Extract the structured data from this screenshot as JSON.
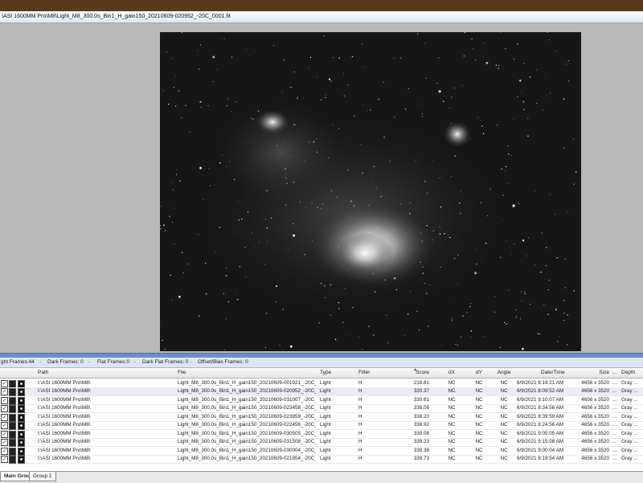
{
  "window": {
    "title": "\\ASI 1600MM Pro\\M8\\Light_M8_300.0s_Bin1_H_gain150_20210609-020952_-20C_0001.fit"
  },
  "counts": {
    "light": "ght Frames:44",
    "dark": "Dark Frames: 0",
    "flat": "Flat Frames:0",
    "dark_flat": "Dark Flat Frames: 0",
    "offset": "Offset/Bias Frames: 0"
  },
  "columns": {
    "path": "Path",
    "file": "File",
    "type": "Type",
    "filter": "Filter",
    "score": "Score",
    "dx": "dX",
    "dy": "dY",
    "angle": "Angle",
    "datetime": "Date/Time",
    "size": "Size",
    "dots": "...",
    "depth": "Depth"
  },
  "rows": [
    {
      "path": "I:\\ASI 1600MM Pro\\M8\\",
      "file": "Light_M8_300.0s_Bin1_H_gain150_20210609-001921_-20C_...",
      "type": "Light",
      "filter": "H",
      "score": "218.81",
      "dx": "NC",
      "dy": "NC",
      "angle": "NC",
      "datetime": "6/9/2021 6:19:21 AM",
      "size": "4656 x 3520",
      "dots": "...",
      "depth": "Gray ..."
    },
    {
      "path": "I:\\ASI 1600MM Pro\\M8\\",
      "file": "Light_M8_300.0s_Bin1_H_gain150_20210609-020952_-20C_...",
      "type": "Light",
      "filter": "H",
      "score": "320.37",
      "dx": "NC",
      "dy": "NC",
      "angle": "NC",
      "datetime": "6/9/2021 8:09:52 AM",
      "size": "4656 x 3520",
      "dots": "...",
      "depth": "Gray ..."
    },
    {
      "path": "I:\\ASI 1600MM Pro\\M8\\",
      "file": "Light_M8_300.0s_Bin1_H_gain150_20210609-031007_-20C_...",
      "type": "Light",
      "filter": "H",
      "score": "330.61",
      "dx": "NC",
      "dy": "NC",
      "angle": "NC",
      "datetime": "6/9/2021 9:10:07 AM",
      "size": "4656 x 3520",
      "dots": "...",
      "depth": "Gray ..."
    },
    {
      "path": "I:\\ASI 1600MM Pro\\M8\\",
      "file": "Light_M8_300.0s_Bin1_H_gain150_20210609-023458_-20C_...",
      "type": "Light",
      "filter": "H",
      "score": "338.08",
      "dx": "NC",
      "dy": "NC",
      "angle": "NC",
      "datetime": "6/9/2021 8:34:58 AM",
      "size": "4656 x 3520",
      "dots": "...",
      "depth": "Gray ..."
    },
    {
      "path": "I:\\ASI 1600MM Pro\\M8\\",
      "file": "Light_M8_300.0s_Bin1_H_gain150_20210609-023959_-20C_...",
      "type": "Light",
      "filter": "H",
      "score": "338.20",
      "dx": "NC",
      "dy": "NC",
      "angle": "NC",
      "datetime": "6/9/2021 8:39:59 AM",
      "size": "4656 x 3520",
      "dots": "...",
      "depth": "Gray ..."
    },
    {
      "path": "I:\\ASI 1600MM Pro\\M8\\",
      "file": "Light_M8_300.0s_Bin1_H_gain150_20210609-022456_-20C_...",
      "type": "Light",
      "filter": "H",
      "score": "338.92",
      "dx": "NC",
      "dy": "NC",
      "angle": "NC",
      "datetime": "6/9/2021 8:24:56 AM",
      "size": "4656 x 3520",
      "dots": "...",
      "depth": "Gray ..."
    },
    {
      "path": "I:\\ASI 1600MM Pro\\M8\\",
      "file": "Light_M8_300.0s_Bin1_H_gain150_20210609-030505_-20C_...",
      "type": "Light",
      "filter": "H",
      "score": "339.08",
      "dx": "NC",
      "dy": "NC",
      "angle": "NC",
      "datetime": "6/9/2021 9:05:05 AM",
      "size": "4656 x 3520",
      "dots": "...",
      "depth": "Gray ..."
    },
    {
      "path": "I:\\ASI 1600MM Pro\\M8\\",
      "file": "Light_M8_300.0s_Bin1_H_gain150_20210609-031508_-20C_...",
      "type": "Light",
      "filter": "H",
      "score": "339.23",
      "dx": "NC",
      "dy": "NC",
      "angle": "NC",
      "datetime": "6/9/2021 9:15:08 AM",
      "size": "4656 x 3520",
      "dots": "...",
      "depth": "Gray ..."
    },
    {
      "path": "I:\\ASI 1600MM Pro\\M8\\",
      "file": "Light_M8_300.0s_Bin1_H_gain150_20210609-030004_-20C_...",
      "type": "Light",
      "filter": "H",
      "score": "339.38",
      "dx": "NC",
      "dy": "NC",
      "angle": "NC",
      "datetime": "6/9/2021 9:00:04 AM",
      "size": "4656 x 3520",
      "dots": "...",
      "depth": "Gray ..."
    },
    {
      "path": "I:\\ASI 1600MM Pro\\M8\\",
      "file": "Light_M8_300.0s_Bin1_H_gain150_20210609-021954_-20C_...",
      "type": "Light",
      "filter": "H",
      "score": "339.73",
      "dx": "NC",
      "dy": "NC",
      "angle": "NC",
      "datetime": "6/9/2021 8:19:54 AM",
      "size": "4656 x 3520",
      "dots": "...",
      "depth": "Gray ..."
    }
  ],
  "tabs": [
    "Main Group",
    "Group 1"
  ],
  "colors": {
    "accent": "#6b90c8",
    "background": "#5a3c1e",
    "viewer": "#b9b9b9"
  }
}
